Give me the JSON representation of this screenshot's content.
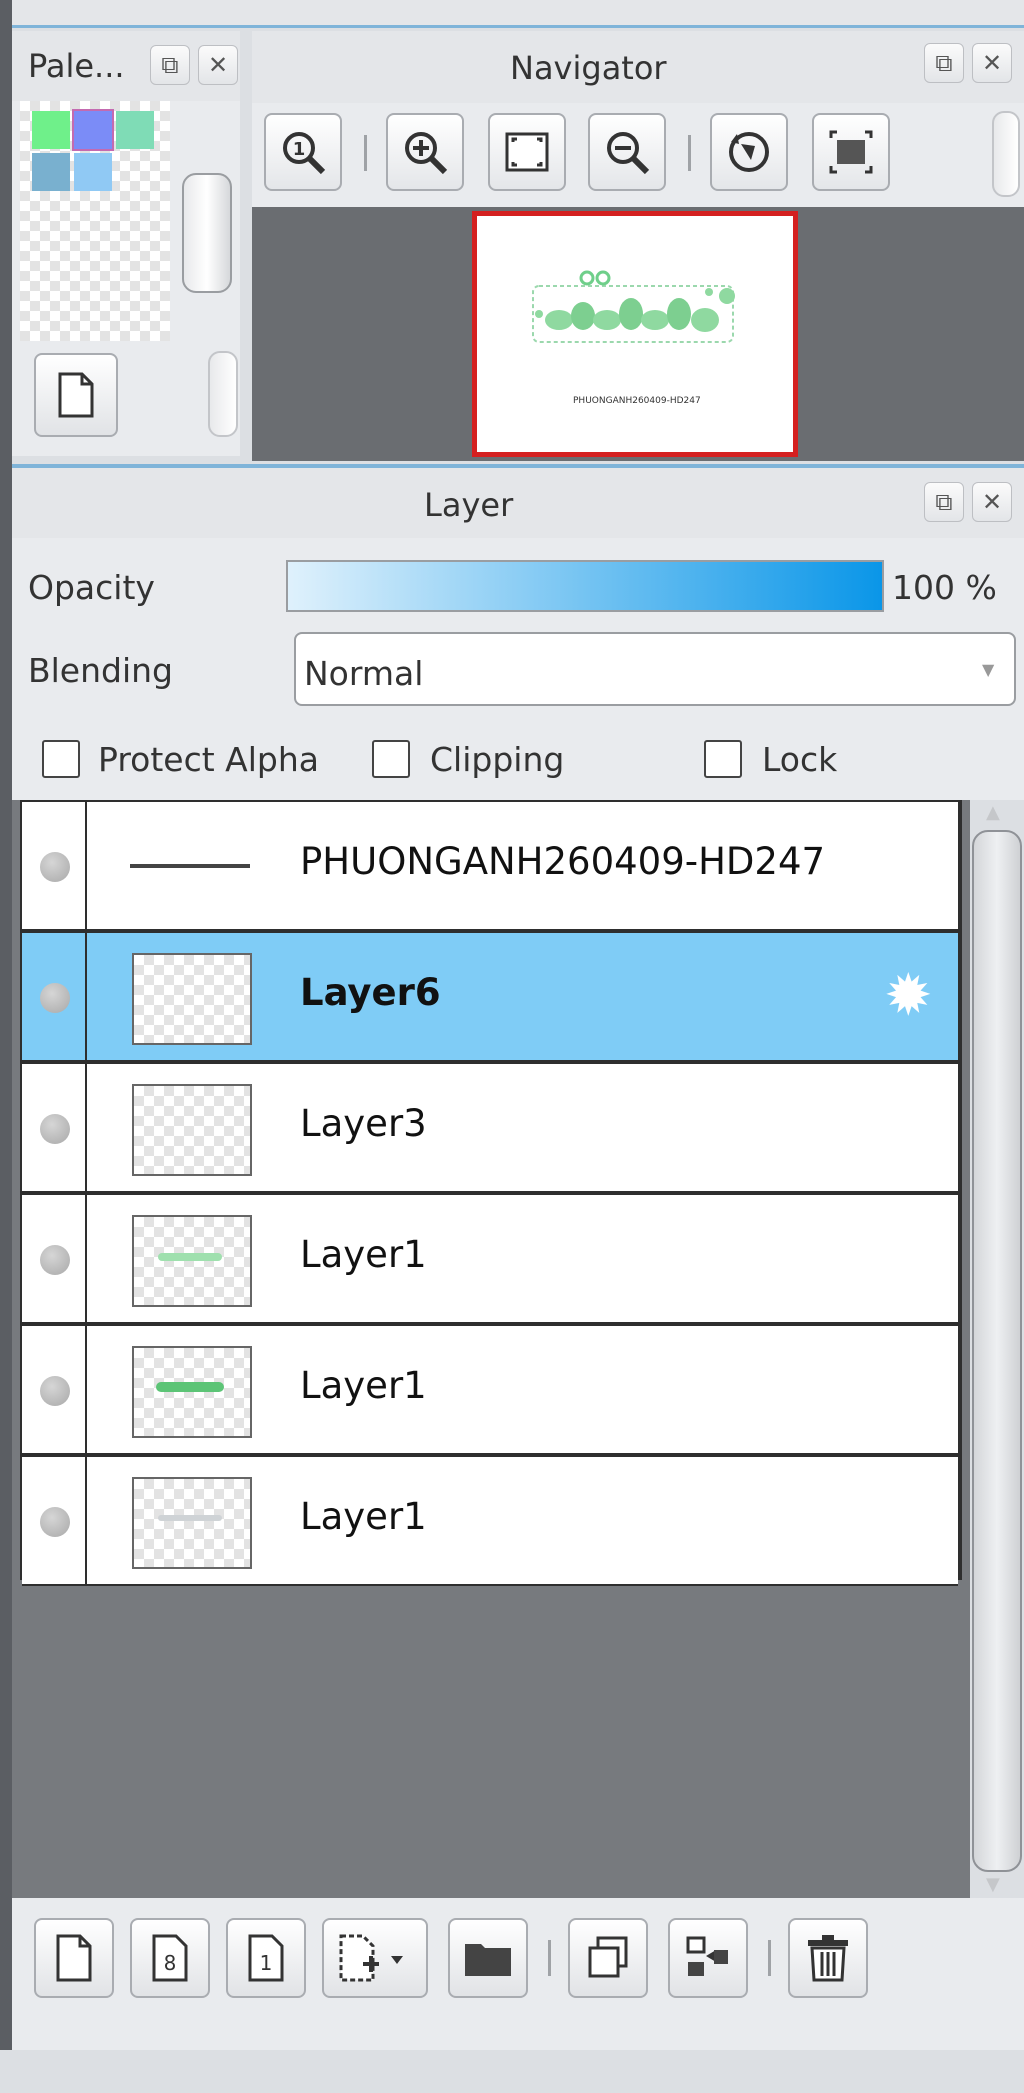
{
  "palette": {
    "title": "Pale...",
    "swatches": [
      "#6ff08a",
      "#7b8cf7",
      "#7fdcb6",
      "#79b0cf",
      "#90c9f4"
    ]
  },
  "navigator": {
    "title": "Navigator",
    "preview_caption": "PHUONGANH260409-HD247"
  },
  "layer_panel": {
    "title": "Layer",
    "opacity_label": "Opacity",
    "opacity_value": "100 %",
    "opacity_level": 1.0,
    "blending_label": "Blending",
    "blending_value": "Normal",
    "protect_alpha_label": "Protect Alpha",
    "clipping_label": "Clipping",
    "lock_label": "Lock",
    "layers": [
      {
        "name": "PHUONGANH260409-HD247",
        "selected": false,
        "type": "text"
      },
      {
        "name": "Layer6",
        "selected": true,
        "type": "raster"
      },
      {
        "name": "Layer3",
        "selected": false,
        "type": "raster"
      },
      {
        "name": "Layer1",
        "selected": false,
        "type": "raster"
      },
      {
        "name": "Layer1",
        "selected": false,
        "type": "raster"
      },
      {
        "name": "Layer1",
        "selected": false,
        "type": "raster"
      }
    ]
  },
  "colors": {
    "accent": "#7fccf6",
    "opacity_bar_start": "#dff1fc",
    "opacity_bar_end": "#0a96e8",
    "canvas_frame": "#d42020",
    "panel_dark": "#777a7e"
  },
  "icons": {
    "window_float": "float-window-icon",
    "window_close": "close-icon",
    "layer_settings": "gear-icon"
  }
}
